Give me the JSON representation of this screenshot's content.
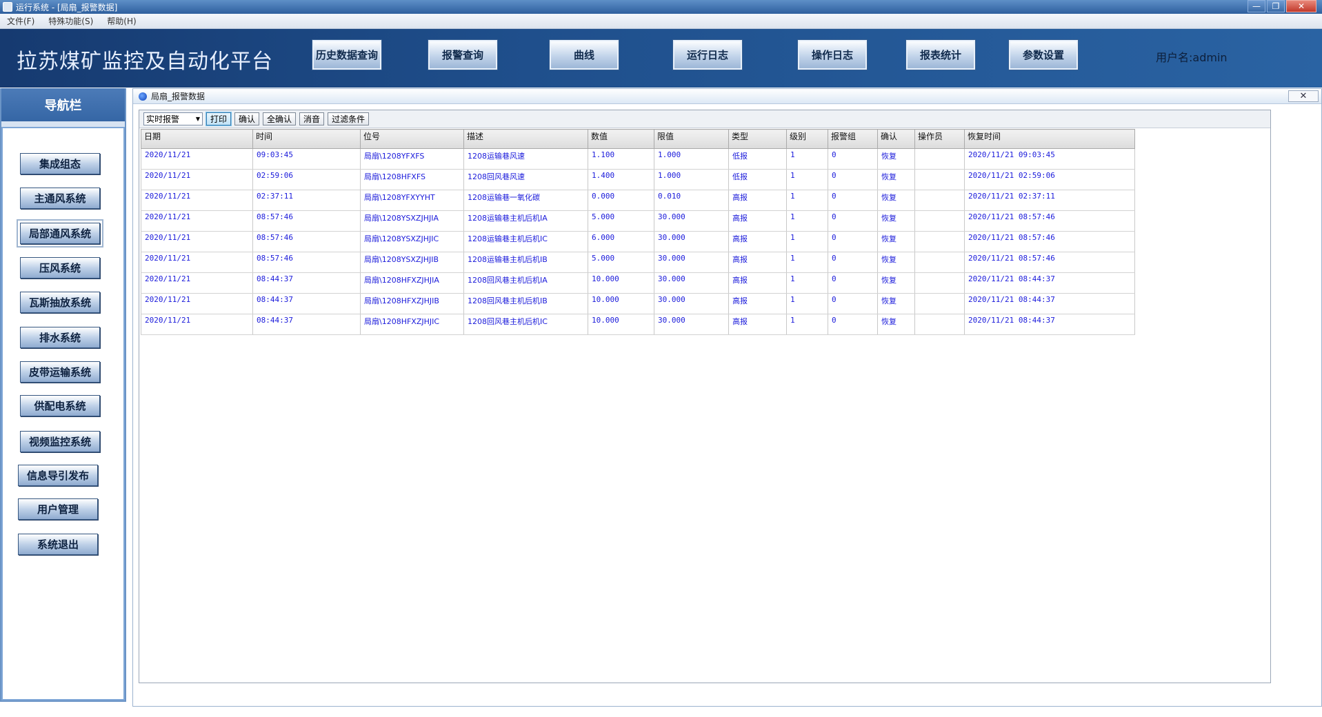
{
  "window": {
    "title": "运行系统 - [局扇_报警数据]"
  },
  "menu": [
    "文件(F)",
    "特殊功能(S)",
    "帮助(H)"
  ],
  "header": {
    "platform_title": "拉苏煤矿监控及自动化平台",
    "buttons": [
      "历史数据查询",
      "报警查询",
      "曲线",
      "运行日志",
      "操作日志",
      "报表统计",
      "参数设置"
    ],
    "user_label": "用户名:admin"
  },
  "nav": {
    "title": "导航栏",
    "items": [
      "集成组态",
      "主通风系统",
      "局部通风系统",
      "压风系统",
      "瓦斯抽放系统",
      "排水系统",
      "皮带运输系统",
      "供配电系统",
      "视频监控系统",
      "信息导引发布",
      "用户管理",
      "系统退出"
    ],
    "active_index": 2
  },
  "inner": {
    "title": "局扇_报警数据",
    "toolbar": {
      "select_value": "实时报警",
      "buttons": [
        "打印",
        "确认",
        "全确认",
        "消音",
        "过滤条件"
      ]
    },
    "columns": [
      "日期",
      "时间",
      "位号",
      "描述",
      "数值",
      "限值",
      "类型",
      "级别",
      "报警组",
      "确认",
      "操作员",
      "恢复时间"
    ],
    "rows": [
      [
        "2020/11/21",
        "09:03:45",
        "局扇\\1208YFXFS",
        "1208运输巷风速",
        "1.100",
        "1.000",
        "低报",
        "1",
        "0",
        "恢复",
        "",
        "2020/11/21 09:03:45"
      ],
      [
        "2020/11/21",
        "02:59:06",
        "局扇\\1208HFXFS",
        "1208回风巷风速",
        "1.400",
        "1.000",
        "低报",
        "1",
        "0",
        "恢复",
        "",
        "2020/11/21 02:59:06"
      ],
      [
        "2020/11/21",
        "02:37:11",
        "局扇\\1208YFXYYHT",
        "1208运输巷一氧化碳",
        "0.000",
        "0.010",
        "高报",
        "1",
        "0",
        "恢复",
        "",
        "2020/11/21 02:37:11"
      ],
      [
        "2020/11/21",
        "08:57:46",
        "局扇\\1208YSXZJHJIA",
        "1208运输巷主机后机IA",
        "5.000",
        "30.000",
        "高报",
        "1",
        "0",
        "恢复",
        "",
        "2020/11/21 08:57:46"
      ],
      [
        "2020/11/21",
        "08:57:46",
        "局扇\\1208YSXZJHJIC",
        "1208运输巷主机后机IC",
        "6.000",
        "30.000",
        "高报",
        "1",
        "0",
        "恢复",
        "",
        "2020/11/21 08:57:46"
      ],
      [
        "2020/11/21",
        "08:57:46",
        "局扇\\1208YSXZJHJIB",
        "1208运输巷主机后机IB",
        "5.000",
        "30.000",
        "高报",
        "1",
        "0",
        "恢复",
        "",
        "2020/11/21 08:57:46"
      ],
      [
        "2020/11/21",
        "08:44:37",
        "局扇\\1208HFXZJHJIA",
        "1208回风巷主机后机IA",
        "10.000",
        "30.000",
        "高报",
        "1",
        "0",
        "恢复",
        "",
        "2020/11/21 08:44:37"
      ],
      [
        "2020/11/21",
        "08:44:37",
        "局扇\\1208HFXZJHJIB",
        "1208回风巷主机后机IB",
        "10.000",
        "30.000",
        "高报",
        "1",
        "0",
        "恢复",
        "",
        "2020/11/21 08:44:37"
      ],
      [
        "2020/11/21",
        "08:44:37",
        "局扇\\1208HFXZJHJIC",
        "1208回风巷主机后机IC",
        "10.000",
        "30.000",
        "高报",
        "1",
        "0",
        "恢复",
        "",
        "2020/11/21 08:44:37"
      ]
    ]
  },
  "colors": {
    "header_dark": "#163a70",
    "header_light": "#2a63a3",
    "table_text": "#1a1adb"
  }
}
